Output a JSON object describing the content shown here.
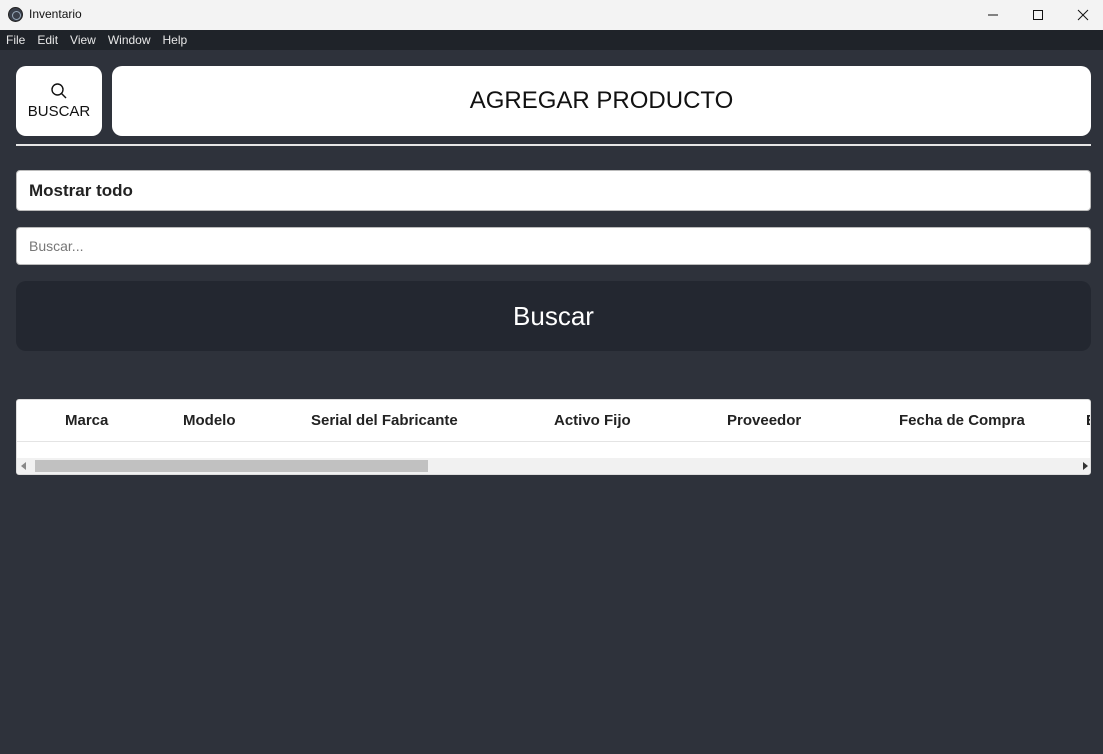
{
  "window": {
    "title": "Inventario"
  },
  "menu": {
    "items": [
      "File",
      "Edit",
      "View",
      "Window",
      "Help"
    ]
  },
  "toolbar": {
    "buscar_label": "BUSCAR",
    "agregar_label": "AGREGAR PRODUCTO"
  },
  "filter": {
    "selected": "Mostrar todo",
    "search_placeholder": "Buscar...",
    "search_value": "",
    "submit_label": "Buscar"
  },
  "table": {
    "columns": [
      "Marca",
      "Modelo",
      "Serial del Fabricante",
      "Activo Fijo",
      "Proveedor",
      "Fecha de Compra",
      "E"
    ],
    "rows": []
  }
}
